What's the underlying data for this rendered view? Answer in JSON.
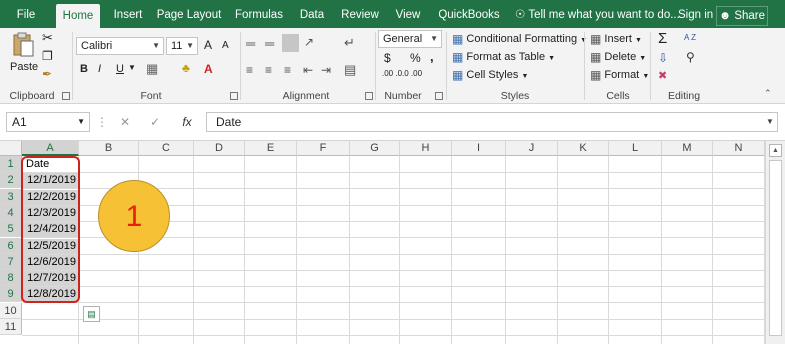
{
  "tabs": [
    "File",
    "Home",
    "Insert",
    "Page Layout",
    "Formulas",
    "Data",
    "Review",
    "View",
    "QuickBooks"
  ],
  "active_tab": "Home",
  "tell_me": "Tell me what you want to do...",
  "sign_in": "Sign in",
  "share": "Share",
  "ribbon": {
    "clipboard": {
      "label": "Clipboard",
      "paste": "Paste"
    },
    "font": {
      "label": "Font",
      "name": "Calibri",
      "size": "11",
      "bold": "B",
      "italic": "I",
      "underline": "U",
      "grow": "A",
      "shrink": "A"
    },
    "alignment": {
      "label": "Alignment"
    },
    "number": {
      "label": "Number",
      "format": "General",
      "currency": "$",
      "percent": "%",
      "comma": ",",
      "inc_dec": ".00 .0",
      "dec_dec": ".0 .00"
    },
    "styles": {
      "label": "Styles",
      "conditional": "Conditional Formatting",
      "format_table": "Format as Table",
      "cell_styles": "Cell Styles"
    },
    "cells": {
      "label": "Cells",
      "insert": "Insert",
      "delete": "Delete",
      "format": "Format"
    },
    "editing": {
      "label": "Editing",
      "sum": "Σ",
      "sort": "A Z"
    }
  },
  "formula_bar": {
    "name_box": "A1",
    "fx": "fx",
    "value": "Date"
  },
  "columns": [
    "A",
    "B",
    "C",
    "D",
    "E",
    "F",
    "G",
    "H",
    "I",
    "J",
    "K",
    "L",
    "M",
    "N"
  ],
  "rows": [
    "1",
    "2",
    "3",
    "4",
    "5",
    "6",
    "7",
    "8",
    "9",
    "10",
    "11"
  ],
  "cells": {
    "header": "Date",
    "dates": [
      "12/1/2019",
      "12/2/2019",
      "12/3/2019",
      "12/4/2019",
      "12/5/2019",
      "12/6/2019",
      "12/7/2019",
      "12/8/2019"
    ]
  },
  "marker_label": "1",
  "colors": {
    "excel_green": "#217346",
    "selection": "#d4d4d4",
    "highlight": "#d0231e",
    "marker": "#f7c136"
  }
}
